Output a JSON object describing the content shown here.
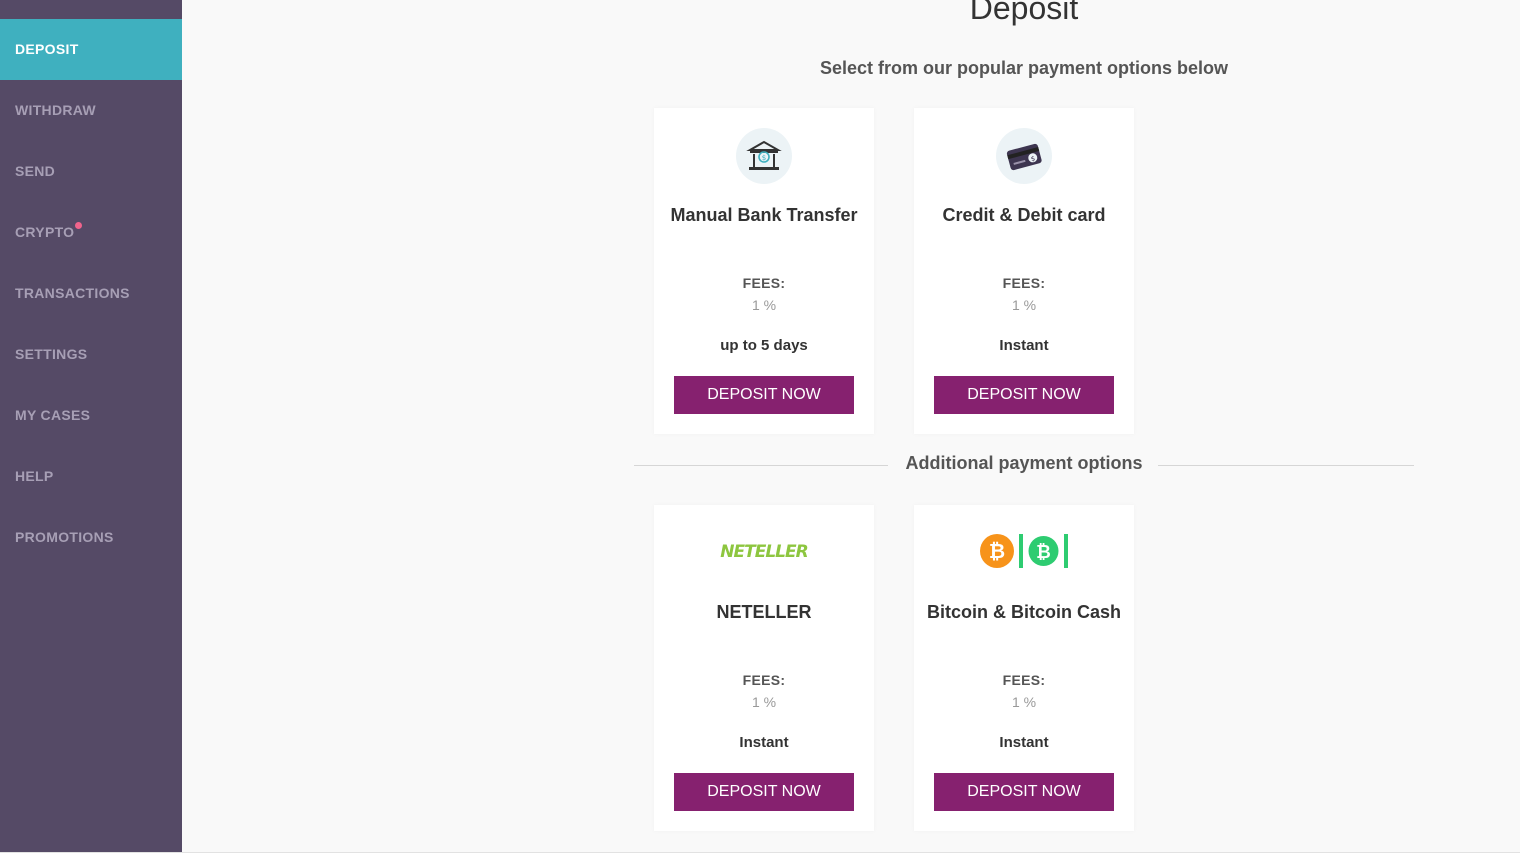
{
  "sidebar": {
    "items": [
      {
        "label": "DEPOSIT",
        "active": true
      },
      {
        "label": "WITHDRAW"
      },
      {
        "label": "SEND"
      },
      {
        "label": "CRYPTO",
        "badge": "notification-dot"
      },
      {
        "label": "TRANSACTIONS"
      },
      {
        "label": "SETTINGS"
      },
      {
        "label": "MY CASES"
      },
      {
        "label": "HELP"
      },
      {
        "label": "PROMOTIONS"
      }
    ]
  },
  "main": {
    "title": "Deposit",
    "subtitle": "Select from our popular payment options below",
    "additional_label": "Additional payment options",
    "popular": [
      {
        "icon": "bank-icon",
        "title": "Manual Bank Transfer",
        "fees_label": "FEES:",
        "fees_value": "1 %",
        "timing": "up to 5 days",
        "button": "DEPOSIT NOW"
      },
      {
        "icon": "credit-card-icon",
        "title": "Credit & Debit card",
        "fees_label": "FEES:",
        "fees_value": "1 %",
        "timing": "Instant",
        "button": "DEPOSIT NOW"
      }
    ],
    "additional": [
      {
        "icon": "neteller-logo",
        "logo_text": "NETELLER",
        "title": "NETELLER",
        "fees_label": "FEES:",
        "fees_value": "1 %",
        "timing": "Instant",
        "button": "DEPOSIT NOW"
      },
      {
        "icon": "bitcoin-icon",
        "title": "Bitcoin & Bitcoin Cash",
        "fees_label": "FEES:",
        "fees_value": "1 %",
        "timing": "Instant",
        "button": "DEPOSIT NOW"
      }
    ]
  },
  "colors": {
    "sidebar_bg": "#554a66",
    "active_nav": "#3fb0bf",
    "button": "#86216f",
    "badge": "#f0648c",
    "bitcoin": "#f7931a",
    "bitcoin_cash": "#2ecc71",
    "neteller": "#8dc63f"
  }
}
